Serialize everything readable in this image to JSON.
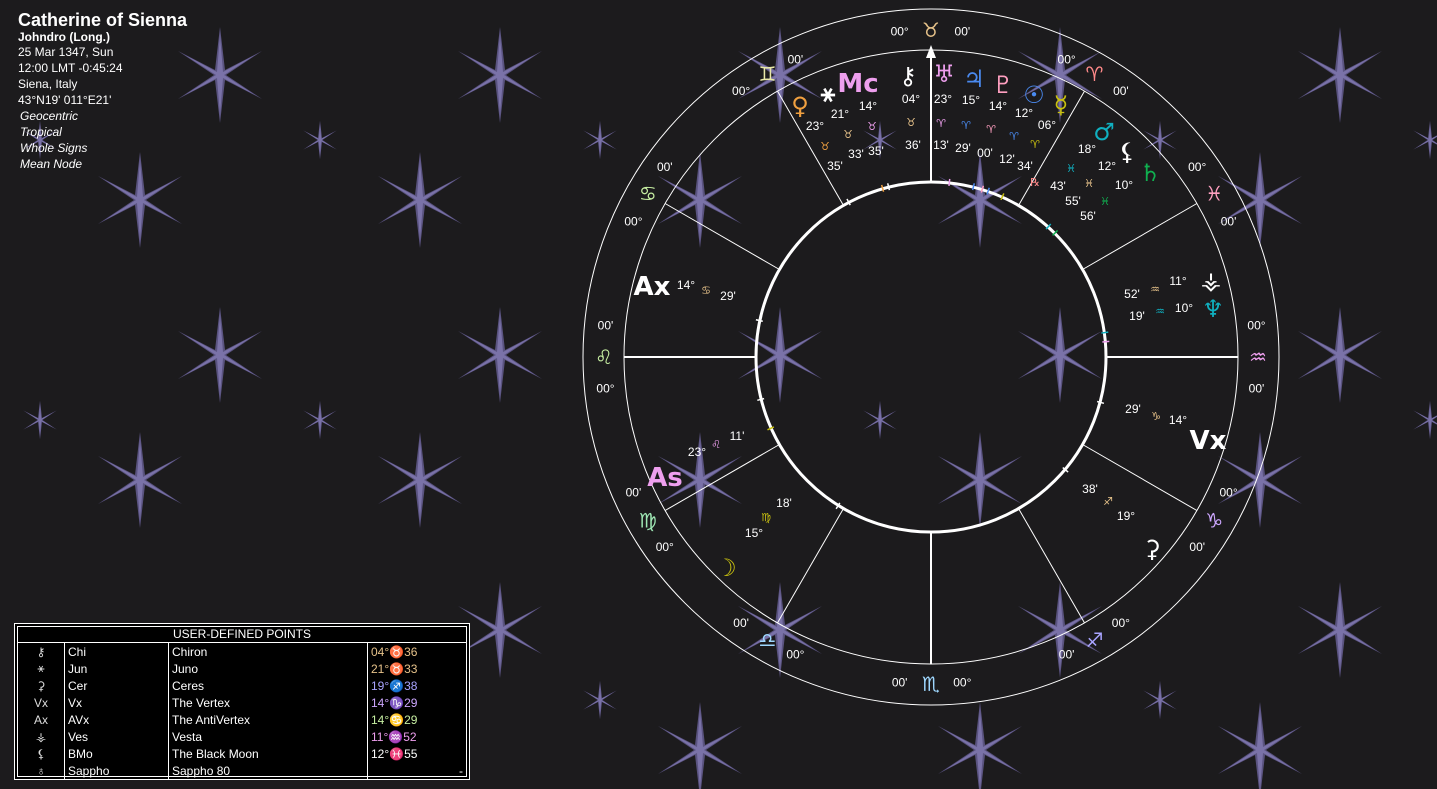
{
  "header": {
    "name": "Catherine of Sienna",
    "system": "Johndro (Long.)",
    "date": "25 Mar 1347, Sun",
    "time": "12:00  LMT -0:45:24",
    "place": "Siena, Italy",
    "coords": "43°N19' 011°E21'",
    "options": [
      "Geocentric",
      "Tropical",
      "Whole Signs",
      "Mean Node"
    ]
  },
  "table": {
    "title": "USER-DEFINED POINTS",
    "rows": [
      {
        "glyph": "⚷",
        "abbr": "Chi",
        "name": "Chiron",
        "pos": "04°♉36",
        "color": "#e6c28a"
      },
      {
        "glyph": "⚹",
        "abbr": "Jun",
        "name": "Juno",
        "pos": "21°♉33",
        "color": "#e6c28a"
      },
      {
        "glyph": "⚳",
        "abbr": "Cer",
        "name": "Ceres",
        "pos": "19°♐38",
        "color": "#a9a4ff"
      },
      {
        "glyph": "Vx",
        "abbr": "Vx",
        "name": "The Vertex",
        "pos": "14°♑29",
        "color": "#cda7ff"
      },
      {
        "glyph": "Ax",
        "abbr": "AVx",
        "name": "The AntiVertex",
        "pos": "14°♋29",
        "color": "#c7efa2"
      },
      {
        "glyph": "⚶",
        "abbr": "Ves",
        "name": "Vesta",
        "pos": "11°♒52",
        "color": "#ee9fee"
      },
      {
        "glyph": "⚸",
        "abbr": "BMo",
        "name": "The Black Moon",
        "pos": "12°♓55",
        "color": "#ffffff"
      },
      {
        "glyph": "♁",
        "abbr": "Sappho",
        "name": "Sappho 80",
        "pos": "-",
        "color": "#ffffff"
      }
    ]
  },
  "wheel": {
    "cusps": [
      {
        "sign": "♉",
        "color": "#e6c28a",
        "l1": "00°",
        "l2": "00'"
      },
      {
        "sign": "♈",
        "color": "#ff8a8a",
        "l1": "00°",
        "l2": "00'"
      },
      {
        "sign": "♓",
        "color": "#ff9fc0",
        "l1": "00°",
        "l2": "00'"
      },
      {
        "sign": "♒",
        "color": "#ee9fee",
        "l1": "00°",
        "l2": "00'"
      },
      {
        "sign": "♑",
        "color": "#cda7ff",
        "l1": "00°",
        "l2": "00'"
      },
      {
        "sign": "♐",
        "color": "#a9a4ff",
        "l1": "00°",
        "l2": "00'"
      },
      {
        "sign": "♏",
        "color": "#9fd8ff",
        "l1": "00°",
        "l2": "00'"
      },
      {
        "sign": "♎",
        "color": "#9fd8ff",
        "l1": "00°",
        "l2": "00'"
      },
      {
        "sign": "♍",
        "color": "#9fe8b5",
        "l1": "00°",
        "l2": "00'"
      },
      {
        "sign": "♌",
        "color": "#c7efa2",
        "l1": "00°",
        "l2": "00'"
      },
      {
        "sign": "♋",
        "color": "#c7efa2",
        "l1": "00°",
        "l2": "00'"
      },
      {
        "sign": "♊",
        "color": "#e8e8a8",
        "l1": "00°",
        "l2": "00'"
      }
    ],
    "planets": [
      {
        "glyph": "♀",
        "color": "#f0a040",
        "deg": "23°",
        "sign": "♉",
        "min": "35'"
      },
      {
        "glyph": "⚹",
        "color": "#ffffff",
        "deg": "21°",
        "sign": "♉",
        "min": "33'"
      },
      {
        "glyph": "Mc",
        "color": "#ee9fee",
        "deg": "14°",
        "sign": "♉",
        "min": "35'"
      },
      {
        "glyph": "⚷",
        "color": "#ffffff",
        "deg": "04°",
        "sign": "♉",
        "min": "36'"
      },
      {
        "glyph": "♅",
        "color": "#ee9fee",
        "deg": "23°",
        "sign": "♈",
        "min": "13'"
      },
      {
        "glyph": "♃",
        "color": "#4a8af0",
        "deg": "15°",
        "sign": "♈",
        "min": "29'"
      },
      {
        "glyph": "♇",
        "color": "#ff9fc0",
        "deg": "14°",
        "sign": "♈",
        "min": "00'"
      },
      {
        "glyph": "☉",
        "color": "#4a8af0",
        "deg": "12°",
        "sign": "♈",
        "min": "12'"
      },
      {
        "glyph": "☿",
        "color": "#c8c010",
        "deg": "06°",
        "sign": "♈",
        "min": "34'",
        "retro": "℞"
      },
      {
        "glyph": "♂",
        "color": "#10b0c0",
        "deg": "18°",
        "sign": "♓",
        "min": "43'"
      },
      {
        "glyph": "⚸",
        "color": "#ffffff",
        "deg": "12°",
        "sign": "♓",
        "min": "55'"
      },
      {
        "glyph": "♄",
        "color": "#10b050",
        "deg": "10°",
        "sign": "♓",
        "min": "56'"
      },
      {
        "glyph": "⚶",
        "color": "#ffffff",
        "deg": "11°",
        "sign": "♒",
        "min": "52'"
      },
      {
        "glyph": "♆",
        "color": "#10b0c0",
        "deg": "10°",
        "sign": "♒",
        "min": "19'"
      },
      {
        "glyph": "Vx",
        "color": "#ffffff",
        "deg": "14°",
        "sign": "♑",
        "min": "29'"
      },
      {
        "glyph": "⚳",
        "color": "#ffffff",
        "deg": "19°",
        "sign": "♐",
        "min": "38'"
      },
      {
        "glyph": "☽",
        "color": "#c8c010",
        "deg": "15°",
        "sign": "♍",
        "min": "18'"
      },
      {
        "glyph": "As",
        "color": "#ee9fee",
        "deg": "23°",
        "sign": "♌",
        "min": "11'"
      },
      {
        "glyph": "Ax",
        "color": "#ffffff",
        "deg": "14°",
        "sign": "♋",
        "min": "29'"
      }
    ]
  }
}
